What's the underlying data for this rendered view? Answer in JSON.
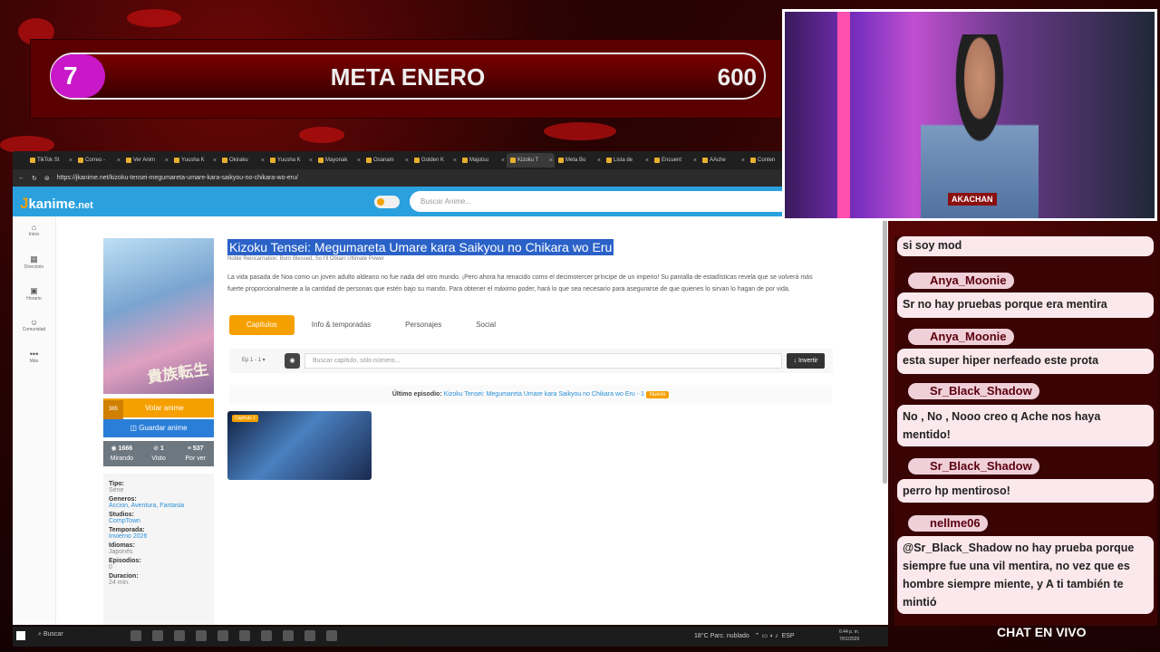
{
  "goal": {
    "count": "7",
    "title": "META ENERO",
    "target": "600"
  },
  "browser": {
    "tabs": [
      "TikTok St",
      "Correo -",
      "Ver Anim",
      "Yuusha K",
      "Okiraku",
      "Yuusha K",
      "Mayonak",
      "Osanam",
      "Golden K",
      "Majutsu",
      "Kizoku T",
      "Meta Bo",
      "Lista de",
      "Encuent",
      "AAche",
      "Conten"
    ],
    "active_tab_index": 10,
    "url": "https://jkanime.net/kizoku-tensei-megumareta-umare-kara-saikyou-no-chikara-wo-eru/"
  },
  "site": {
    "logo_accent": "J",
    "logo_main": "kanime",
    "logo_suffix": ".net",
    "search_placeholder": "Buscar Anime...",
    "sidebar": [
      {
        "icon": "home-icon",
        "glyph": "⌂",
        "label": "Inicio"
      },
      {
        "icon": "grid-icon",
        "glyph": "▦",
        "label": "Directorio"
      },
      {
        "icon": "calendar-icon",
        "glyph": "▣",
        "label": "Horario"
      },
      {
        "icon": "users-icon",
        "glyph": "☺",
        "label": "Comunidad"
      },
      {
        "icon": "more-icon",
        "glyph": "•••",
        "label": "Más"
      }
    ]
  },
  "anime": {
    "title": "Kizoku Tensei: Megumareta Umare kara Saikyou no Chikara wo Eru",
    "alt_title": "Noble Reincarnation: Born Blessed, So I'll Obtain Ultimate Power",
    "synopsis": "La vida pasada de Noa como un joven adulto aldeano no fue nada del otro mundo. ¡Pero ahora ha renacido como el decimotercer príncipe de un imperio! Su pantalla de estadísticas revela que se volverá más fuerte proporcionalmente a la cantidad de personas que estén bajo su mando. Para obtener el máximo poder, hará lo que sea necesario para asegurarse de que quienes lo sirvan lo hagan de por vida.",
    "cover_text": "貴族転生",
    "votes": "365",
    "vote_label": "Votar anime",
    "save_label": "Guardar anime",
    "stats": [
      {
        "icon": "eye-icon",
        "glyph": "◉",
        "value": "1666",
        "label": "Mirando"
      },
      {
        "icon": "check-icon",
        "glyph": "⊘",
        "value": "1",
        "label": "Visto"
      },
      {
        "icon": "list-icon",
        "glyph": "≡",
        "value": "537",
        "label": "Por ver"
      }
    ],
    "info": {
      "type_key": "Tipo:",
      "type_val": "Serie",
      "genres_key": "Generos:",
      "genres_val": "Accion, Aventura, Fantasia",
      "studio_key": "Studios:",
      "studio_val": "CompTown",
      "season_key": "Temporada:",
      "season_val": "Invierno 2026",
      "lang_key": "Idiomas:",
      "lang_val": "Japonés",
      "eps_key": "Episodios:",
      "eps_val": "0",
      "dur_key": "Duracion:",
      "dur_val": "24 min."
    },
    "tabs": [
      "Capítulos",
      "Info & temporadas",
      "Personajes",
      "Social"
    ],
    "ep_select": "Ep 1 - 1",
    "ep_search_placeholder": "Buscar capítulo, sólo número...",
    "invert_label": "↓ Invertir",
    "last_ep_label": "Último episodio:",
    "last_ep_link": "Kizoku Tensei: Megumareta Umare kara Saikyou no Chikara wo Eru - 1",
    "new_badge": "Nuevo",
    "episode_badge": "Capítulo 1"
  },
  "taskbar": {
    "search": "Buscar",
    "weather": "18°C Parc. nublado",
    "lang": "ESP",
    "time": "6:44 p. m.",
    "date": "7/01/2026"
  },
  "chat": {
    "top_fragment": "si soy mod",
    "messages": [
      {
        "user": "Anya_Moonie",
        "text": "Sr no hay pruebas porque era mentira"
      },
      {
        "user": "Anya_Moonie",
        "text": "esta super hiper nerfeado este prota"
      },
      {
        "user": "Sr_Black_Shadow",
        "text": "No , No , Nooo creo q Ache nos haya mentido!"
      },
      {
        "user": "Sr_Black_Shadow",
        "text": "perro hp mentiroso!"
      },
      {
        "user": "nellme06",
        "text": "@Sr_Black_Shadow no hay prueba porque siempre fue una vil mentira, no vez que es hombre siempre miente, y A ti también te mintió"
      }
    ],
    "footer": "CHAT EN VIVO"
  },
  "webcam": {
    "badge": "AKACHAN"
  }
}
